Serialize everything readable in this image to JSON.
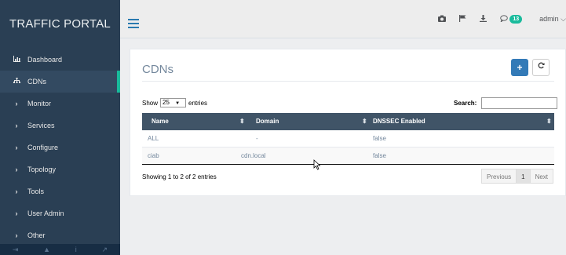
{
  "sidebar": {
    "brand": "TRAFFIC PORTAL",
    "items": [
      {
        "label": "Dashboard",
        "icon": "bar-chart-icon"
      },
      {
        "label": "CDNs",
        "icon": "sitemap-icon",
        "active": true
      },
      {
        "label": "Monitor",
        "icon": "chevron-right-icon"
      },
      {
        "label": "Services",
        "icon": "chevron-right-icon"
      },
      {
        "label": "Configure",
        "icon": "chevron-right-icon"
      },
      {
        "label": "Topology",
        "icon": "chevron-right-icon"
      },
      {
        "label": "Tools",
        "icon": "chevron-right-icon"
      },
      {
        "label": "User Admin",
        "icon": "chevron-right-icon"
      },
      {
        "label": "Other",
        "icon": "chevron-right-icon"
      }
    ],
    "footer_icons": [
      "logout-icon",
      "user-icon",
      "info-icon",
      "external-link-icon"
    ]
  },
  "topbar": {
    "icons": [
      "camera-icon",
      "flag-icon",
      "download-icon",
      "comment-icon"
    ],
    "notification_count": "13",
    "user": "admin"
  },
  "panel": {
    "title": "CDNs",
    "add_icon": "plus-icon",
    "refresh_icon": "refresh-icon",
    "show_label": "Show",
    "page_length": "25",
    "entries_label": "entries",
    "search_label": "Search:",
    "search_value": "",
    "columns": [
      "Name",
      "Domain",
      "DNSSEC Enabled"
    ],
    "rows": [
      [
        "ALL",
        "-",
        "false"
      ],
      [
        "ciab",
        "cdn.local",
        "false"
      ]
    ],
    "info": "Showing 1 to 2 of 2 entries",
    "pager": {
      "previous": "Previous",
      "page": "1",
      "next": "Next"
    }
  },
  "colors": {
    "sidebar_bg": "#2a3f54",
    "accent": "#1abb9c",
    "primary_button": "#337ab7",
    "table_header": "#405467"
  }
}
